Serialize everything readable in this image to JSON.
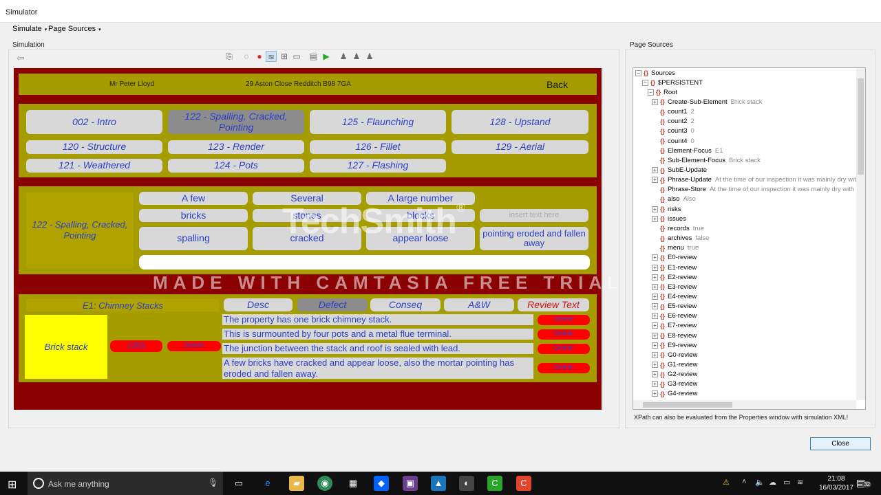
{
  "window": {
    "title": "Simulator"
  },
  "menu": {
    "simulate": "Simulate",
    "page_sources": "Page Sources",
    "caret": "▾"
  },
  "sections": {
    "simulation": "Simulation",
    "page_sources": "Page Sources"
  },
  "scene": {
    "header": {
      "name": "Mr Peter Lloyd",
      "address": "29 Aston Close  Redditch B98 7GA",
      "back": "Back"
    },
    "sections_grid": [
      "002 - Intro",
      "122 - Spalling, Cracked, Pointing",
      "125 - Flaunching",
      "128 - Upstand",
      "120 - Structure",
      "123 - Render",
      "126 - Fillet",
      "129 - Aerial",
      "121 - Weathered",
      "124 - Pots",
      "127 - Flashing"
    ],
    "selected_section": "122 - Spalling, Cracked, Pointing",
    "quantities": [
      "A few",
      "Several",
      "A large number"
    ],
    "words_row1": [
      "bricks",
      "stones",
      "blocks",
      "insert text here"
    ],
    "words_row2": [
      "spalling",
      "cracked",
      "appear loose",
      "pointing eroded and fallen away"
    ],
    "element_title": "E1: Chimney Stacks",
    "tabs": [
      "Desc",
      "Defect",
      "Conseq",
      "A&W",
      "Review Text"
    ],
    "sub_element": "Brick stack",
    "cr_badge": "CR3",
    "delete_label": "Delete",
    "phrases": [
      "The property has one brick chimney stack.",
      "This is surmounted by four pots and a metal flue terminal.",
      "The junction between the stack and roof is sealed with lead.",
      "A few bricks have cracked and appear loose, also the mortar pointing has eroded and fallen away."
    ],
    "watermark_logo": "TechSmith",
    "watermark_reg": "®",
    "watermark_text": "MADE WITH CAMTASIA FREE TRIAL"
  },
  "tree": {
    "rows": [
      {
        "label": "Sources",
        "val": "",
        "exp": "-"
      },
      {
        "label": "$PERSISTENT",
        "val": "",
        "exp": "-"
      },
      {
        "label": "Root",
        "val": "",
        "exp": "-"
      },
      {
        "label": "Create-Sub-Element",
        "val": "Brick stack",
        "exp": "+"
      },
      {
        "label": "count1",
        "val": "2",
        "exp": ""
      },
      {
        "label": "count2",
        "val": "2",
        "exp": ""
      },
      {
        "label": "count3",
        "val": "0",
        "exp": ""
      },
      {
        "label": "count4",
        "val": "0",
        "exp": ""
      },
      {
        "label": "Element-Focus",
        "val": "E1",
        "exp": ""
      },
      {
        "label": "Sub-Element-Focus",
        "val": "Brick stack",
        "exp": ""
      },
      {
        "label": "SubE-Update",
        "val": "",
        "exp": "+"
      },
      {
        "label": "Phrase-Update",
        "val": "At the time of our inspection it was mainly dry with",
        "exp": "+"
      },
      {
        "label": "Phrase-Store",
        "val": "At the time of our inspection it was mainly dry with in",
        "exp": ""
      },
      {
        "label": "also",
        "val": "Also",
        "exp": ""
      },
      {
        "label": "risks",
        "val": "",
        "exp": "+"
      },
      {
        "label": "issues",
        "val": "",
        "exp": "+"
      },
      {
        "label": "records",
        "val": "true",
        "exp": ""
      },
      {
        "label": "archives",
        "val": "false",
        "exp": ""
      },
      {
        "label": "menu",
        "val": "true",
        "exp": ""
      },
      {
        "label": "E0-review",
        "val": "",
        "exp": "+"
      },
      {
        "label": "E1-review",
        "val": "",
        "exp": "+"
      },
      {
        "label": "E2-review",
        "val": "",
        "exp": "+"
      },
      {
        "label": "E3-review",
        "val": "",
        "exp": "+"
      },
      {
        "label": "E4-review",
        "val": "",
        "exp": "+"
      },
      {
        "label": "E5-review",
        "val": "",
        "exp": "+"
      },
      {
        "label": "E6-review",
        "val": "",
        "exp": "+"
      },
      {
        "label": "E7-review",
        "val": "",
        "exp": "+"
      },
      {
        "label": "E8-review",
        "val": "",
        "exp": "+"
      },
      {
        "label": "E9-review",
        "val": "",
        "exp": "+"
      },
      {
        "label": "G0-review",
        "val": "",
        "exp": "+"
      },
      {
        "label": "G1-review",
        "val": "",
        "exp": "+"
      },
      {
        "label": "G2-review",
        "val": "",
        "exp": "+"
      },
      {
        "label": "G3-review",
        "val": "",
        "exp": "+"
      },
      {
        "label": "G4-review",
        "val": "",
        "exp": "+"
      }
    ]
  },
  "xpath_note": "XPath can also be evaluated from the Properties window with simulation XML!",
  "close_label": "Close",
  "taskbar": {
    "search_placeholder": "Ask me anything",
    "time": "21:08",
    "date": "16/03/2017",
    "badge": "32"
  },
  "colors": {
    "scene_bg": "#8b0000",
    "olive": "#a59d00",
    "button": "#d8d8d8",
    "delete": "#ff0000",
    "link_text": "#2b3fc7",
    "sub_element": "#ffff00"
  }
}
